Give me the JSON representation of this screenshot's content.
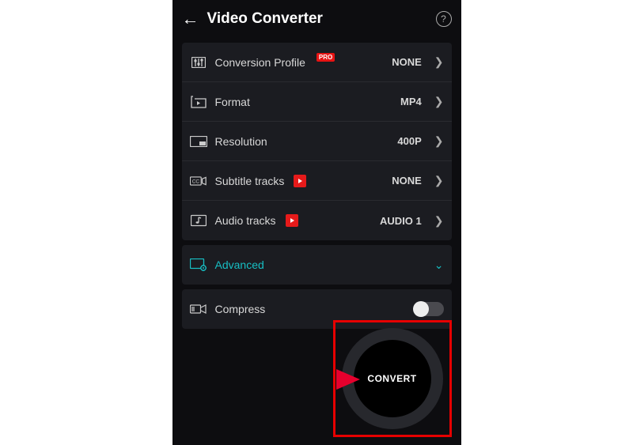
{
  "header": {
    "title": "Video Converter"
  },
  "settings": {
    "conversion_profile": {
      "label": "Conversion Profile",
      "value": "NONE",
      "badge": "PRO"
    },
    "format": {
      "label": "Format",
      "value": "MP4"
    },
    "resolution": {
      "label": "Resolution",
      "value": "400P"
    },
    "subtitle": {
      "label": "Subtitle tracks",
      "value": "NONE"
    },
    "audio": {
      "label": "Audio tracks",
      "value": "AUDIO 1"
    }
  },
  "advanced": {
    "label": "Advanced"
  },
  "compress": {
    "label": "Compress",
    "enabled": false
  },
  "convert": {
    "label": "CONVERT"
  }
}
